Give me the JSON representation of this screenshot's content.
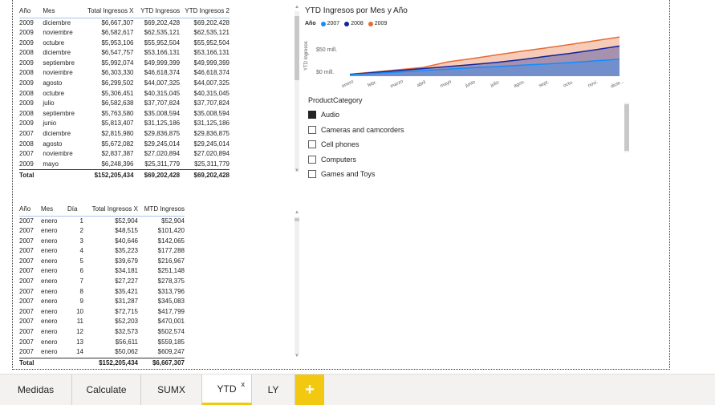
{
  "table_top": {
    "headers": [
      "Año",
      "Mes",
      "Total Ingresos X",
      "YTD Ingresos",
      "YTD Ingresos 2"
    ],
    "rows": [
      [
        "2009",
        "diciembre",
        "$6,667,307",
        "$69,202,428",
        "$69,202,428"
      ],
      [
        "2009",
        "noviembre",
        "$6,582,617",
        "$62,535,121",
        "$62,535,121"
      ],
      [
        "2009",
        "octubre",
        "$5,953,106",
        "$55,952,504",
        "$55,952,504"
      ],
      [
        "2008",
        "diciembre",
        "$6,547,757",
        "$53,166,131",
        "$53,166,131"
      ],
      [
        "2009",
        "septiembre",
        "$5,992,074",
        "$49,999,399",
        "$49,999,399"
      ],
      [
        "2008",
        "noviembre",
        "$6,303,330",
        "$46,618,374",
        "$46,618,374"
      ],
      [
        "2009",
        "agosto",
        "$6,299,502",
        "$44,007,325",
        "$44,007,325"
      ],
      [
        "2008",
        "octubre",
        "$5,306,451",
        "$40,315,045",
        "$40,315,045"
      ],
      [
        "2009",
        "julio",
        "$6,582,638",
        "$37,707,824",
        "$37,707,824"
      ],
      [
        "2008",
        "septiembre",
        "$5,763,580",
        "$35,008,594",
        "$35,008,594"
      ],
      [
        "2009",
        "junio",
        "$5,813,407",
        "$31,125,186",
        "$31,125,186"
      ],
      [
        "2007",
        "diciembre",
        "$2,815,980",
        "$29,836,875",
        "$29,836,875"
      ],
      [
        "2008",
        "agosto",
        "$5,672,082",
        "$29,245,014",
        "$29,245,014"
      ],
      [
        "2007",
        "noviembre",
        "$2,837,387",
        "$27,020,894",
        "$27,020,894"
      ],
      [
        "2009",
        "mayo",
        "$6,248,396",
        "$25,311,779",
        "$25,311,779"
      ]
    ],
    "total": [
      "Total",
      "",
      "$152,205,434",
      "$69,202,428",
      "$69,202,428"
    ]
  },
  "table_bottom": {
    "headers": [
      "Año",
      "Mes",
      "Día",
      "Total Ingresos X",
      "MTD Ingresos"
    ],
    "rows": [
      [
        "2007",
        "enero",
        "1",
        "$52,904",
        "$52,904"
      ],
      [
        "2007",
        "enero",
        "2",
        "$48,515",
        "$101,420"
      ],
      [
        "2007",
        "enero",
        "3",
        "$40,646",
        "$142,065"
      ],
      [
        "2007",
        "enero",
        "4",
        "$35,223",
        "$177,288"
      ],
      [
        "2007",
        "enero",
        "5",
        "$39,679",
        "$216,967"
      ],
      [
        "2007",
        "enero",
        "6",
        "$34,181",
        "$251,148"
      ],
      [
        "2007",
        "enero",
        "7",
        "$27,227",
        "$278,375"
      ],
      [
        "2007",
        "enero",
        "8",
        "$35,421",
        "$313,796"
      ],
      [
        "2007",
        "enero",
        "9",
        "$31,287",
        "$345,083"
      ],
      [
        "2007",
        "enero",
        "10",
        "$72,715",
        "$417,799"
      ],
      [
        "2007",
        "enero",
        "11",
        "$52,203",
        "$470,001"
      ],
      [
        "2007",
        "enero",
        "12",
        "$32,573",
        "$502,574"
      ],
      [
        "2007",
        "enero",
        "13",
        "$56,611",
        "$559,185"
      ],
      [
        "2007",
        "enero",
        "14",
        "$50,062",
        "$609,247"
      ]
    ],
    "total": [
      "Total",
      "",
      "",
      "$152,205,434",
      "$6,667,307"
    ]
  },
  "chart": {
    "title": "YTD Ingresos por Mes y Año",
    "legend_title": "Año",
    "y_axis_label": "YTD Ingresos",
    "y_ticks": [
      "$50 mill.",
      "$0 mill."
    ],
    "colors": {
      "2007": "#118dff",
      "2008": "#12239e",
      "2009": "#e66c37"
    }
  },
  "chart_data": {
    "type": "area",
    "title": "YTD Ingresos por Mes y Año",
    "xlabel": "",
    "ylabel": "YTD Ingresos",
    "categories": [
      "enero",
      "febr.",
      "marzo",
      "abril",
      "mayo",
      "junio",
      "julio",
      "agos.",
      "sept.",
      "octu.",
      "novi.",
      "dicie..."
    ],
    "ylim": [
      0,
      75
    ],
    "series": [
      {
        "name": "2007",
        "values": [
          2.5,
          5,
          7.5,
          10,
          12.5,
          15,
          17,
          19.5,
          21.5,
          24,
          27.0,
          29.8
        ]
      },
      {
        "name": "2008",
        "values": [
          3,
          6.5,
          10,
          13.5,
          17,
          20.5,
          24.5,
          29.2,
          35.0,
          40.3,
          46.6,
          53.2
        ]
      },
      {
        "name": "2009",
        "values": [
          3.5,
          7.5,
          11.5,
          15.5,
          25.3,
          31.1,
          37.7,
          44.0,
          50.0,
          56.0,
          62.5,
          69.2
        ]
      }
    ]
  },
  "slicer": {
    "title": "ProductCategory",
    "items": [
      {
        "label": "Audio",
        "checked": true
      },
      {
        "label": "Cameras and camcorders",
        "checked": false
      },
      {
        "label": "Cell phones",
        "checked": false
      },
      {
        "label": "Computers",
        "checked": false
      },
      {
        "label": "Games and Toys",
        "checked": false
      }
    ]
  },
  "tabs": [
    {
      "label": "Medidas",
      "active": false
    },
    {
      "label": "Calculate",
      "active": false
    },
    {
      "label": "SUMX",
      "active": false
    },
    {
      "label": "YTD",
      "active": true
    },
    {
      "label": "LY",
      "active": false
    }
  ],
  "add_tab_label": "+",
  "close_label": "x"
}
